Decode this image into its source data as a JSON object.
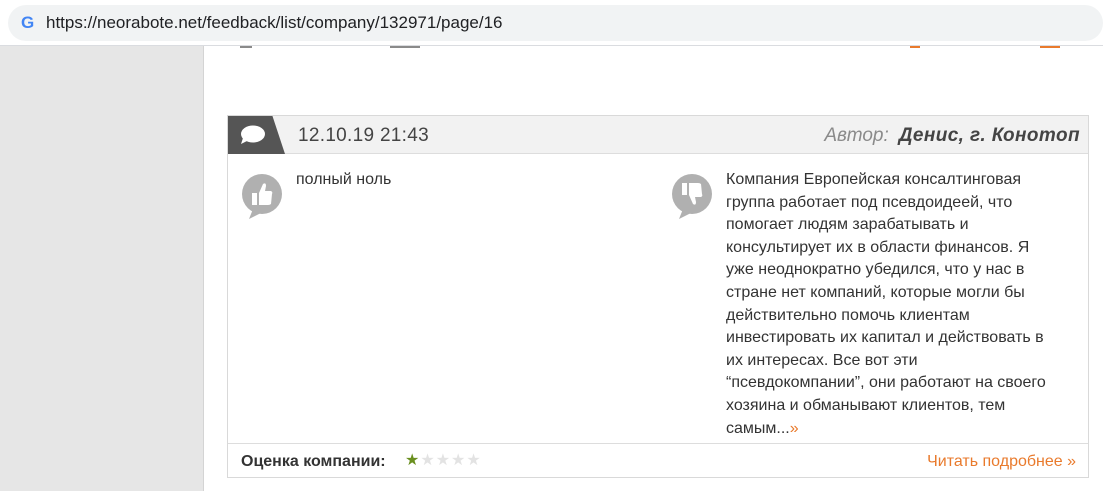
{
  "browser": {
    "url": "https://neorabote.net/feedback/list/company/132971/page/16"
  },
  "review": {
    "date": "12.10.19 21:43",
    "author_label": "Автор:",
    "author_name": "Денис,  г. Конотоп",
    "pro_text": "полный ноль",
    "con_lines": [
      "Компания Европейская консалтинговая",
      "группа работает под псевдоидеей, что",
      "помогает людям зарабатывать и",
      "консультирует их в области финансов. Я",
      "уже неоднократно убедился, что у нас в",
      "стране нет компаний, которые могли бы",
      "действительно помочь клиентам",
      "инвестировать их капитал и действовать в",
      "их интересах. Все вот эти",
      "“псевдокомпании”, они работают на своего",
      "хозяина и обманывают клиентов, тем",
      "самым..."
    ],
    "con_more": "»",
    "rating_label": "Оценка компании:",
    "rating": 1,
    "rating_max": 5,
    "read_more": "Читать подробнее »"
  },
  "colors": {
    "accent": "#e97a2c",
    "star_on": "#6a8f1f",
    "star_off": "#e3e3e3",
    "icon_gray": "#b0b0b0",
    "tab_dark": "#555555"
  },
  "icons": {
    "browser": "google-icon",
    "header": "comment-bubble-icon",
    "pro": "thumbs-up-icon",
    "con": "thumbs-down-icon"
  }
}
